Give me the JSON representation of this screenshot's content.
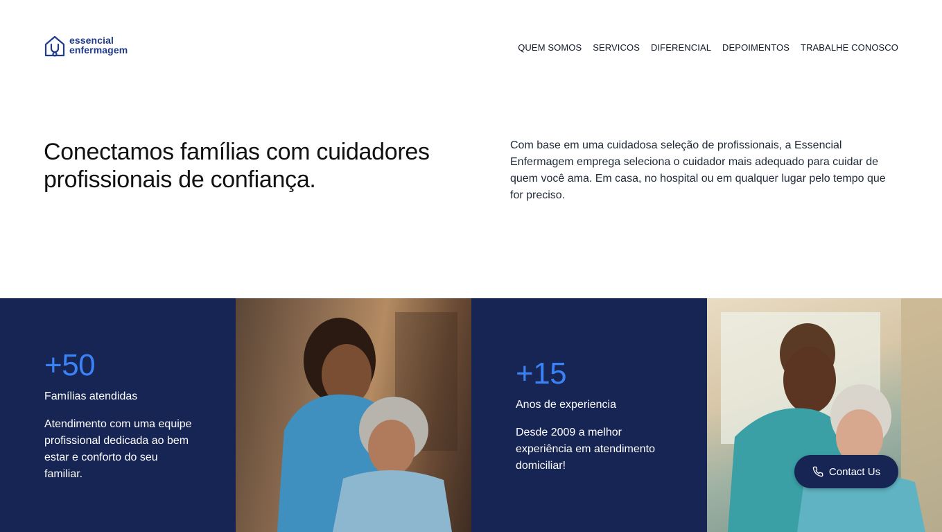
{
  "brand": {
    "line1": "essencial",
    "line2": "enfermagem",
    "color": "#1f3a8a"
  },
  "nav": {
    "items": [
      {
        "label": "QUEM SOMOS"
      },
      {
        "label": "SERVICOS"
      },
      {
        "label": "DIFERENCIAL"
      },
      {
        "label": "DEPOIMENTOS"
      },
      {
        "label": "TRABALHE CONOSCO"
      }
    ]
  },
  "hero": {
    "title": "Conectamos famílias com cuidadores profissionais de confiança.",
    "description": "Com base em uma cuidadosa seleção de profissionais, a Essencial Enfermagem emprega seleciona o cuidador mais adequado para cuidar de quem você ama. Em casa, no hospital ou em qualquer lugar pelo tempo que for preciso."
  },
  "stats": [
    {
      "number": "+50",
      "label": "Famílias atendidas",
      "description": "Atendimento com uma equipe profissional dedicada ao bem estar e conforto do seu familiar."
    },
    {
      "number": "+15",
      "label": "Anos de experiencia",
      "description": "Desde 2009 a melhor experiência em atendimento domiciliar!"
    }
  ],
  "contact": {
    "label": "Contact Us",
    "icon": "phone-icon"
  },
  "colors": {
    "navy": "#172554",
    "accent_blue": "#3b82f6"
  }
}
